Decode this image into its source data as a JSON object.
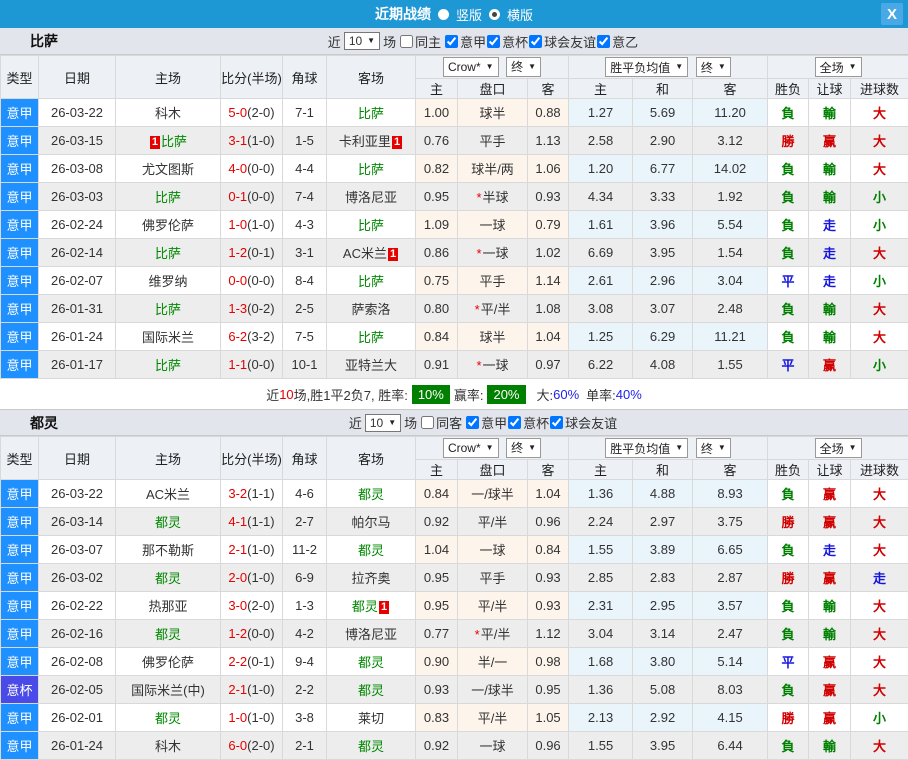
{
  "colors": {
    "titlebar": "#1E97D5",
    "close_btn": "#48A9E6",
    "band_bg": "#E2E5EC",
    "header_bg": "#EDF0F5",
    "serie_a": "#1E90FF",
    "coppa": "#4A4AE8",
    "focus_team": "#008800",
    "win_red": "#D10000",
    "lose_green": "#008000",
    "draw_blue": "#1515E0",
    "score_red": "#E60000",
    "tint_crow": "#FDF5EC",
    "tint_avg": "#EAF4FB",
    "badge_green": "#008000",
    "pct_blue": "#2222EE",
    "row_alt": "#EDEDED"
  },
  "titlebar": {
    "title": "近期战绩",
    "layout_vertical": "竖版",
    "layout_horizontal": "横版",
    "close": "X"
  },
  "columns": {
    "type": "类型",
    "date": "日期",
    "home": "主场",
    "score": "比分(半场)",
    "corner": "角球",
    "away": "客场",
    "h": "主",
    "handicap": "盘口",
    "a": "客",
    "eh": "主",
    "draw": "和",
    "ea": "客",
    "result": "胜负",
    "let": "让球",
    "goals": "进球数"
  },
  "selects": {
    "bookmaker": "Crow*",
    "final": "终",
    "wdl": "胜平负均值",
    "final2": "终",
    "scope": "全场"
  },
  "sections": [
    {
      "team": "比萨",
      "filter": {
        "near": "近",
        "count": "10",
        "games": "场",
        "same": {
          "label": "同主",
          "checked": false
        },
        "leagues": [
          {
            "label": "意甲",
            "checked": true
          },
          {
            "label": "意杯",
            "checked": true
          },
          {
            "label": "球会友谊",
            "checked": true
          },
          {
            "label": "意乙",
            "checked": true
          }
        ]
      },
      "rows": [
        {
          "lg": "意甲",
          "lgc": "jia",
          "date": "26-03-22",
          "home": "科木",
          "hf": 0,
          "hcard": 0,
          "ft": "5-0",
          "ht": "(2-0)",
          "cn": "7-1",
          "away": "比萨",
          "af": 1,
          "acard": 0,
          "o1": "1.00",
          "star": 0,
          "hc": "球半",
          "o2": "0.88",
          "e1": "1.27",
          "e2": "5.69",
          "e3": "11.20",
          "r": "負",
          "rc": "g",
          "h": "輸",
          "hcl": "g",
          "g": "大",
          "gc": "r"
        },
        {
          "lg": "意甲",
          "lgc": "jia",
          "date": "26-03-15",
          "home": "比萨",
          "hf": 1,
          "hcard": 1,
          "ft": "3-1",
          "ht": "(1-0)",
          "cn": "1-5",
          "away": "卡利亚里",
          "af": 0,
          "acard": 1,
          "o1": "0.76",
          "star": 0,
          "hc": "平手",
          "o2": "1.13",
          "e1": "2.58",
          "e2": "2.90",
          "e3": "3.12",
          "r": "勝",
          "rc": "r",
          "h": "赢",
          "hcl": "r",
          "g": "大",
          "gc": "r"
        },
        {
          "lg": "意甲",
          "lgc": "jia",
          "date": "26-03-08",
          "home": "尤文图斯",
          "hf": 0,
          "hcard": 0,
          "ft": "4-0",
          "ht": "(0-0)",
          "cn": "4-4",
          "away": "比萨",
          "af": 1,
          "acard": 0,
          "o1": "0.82",
          "star": 0,
          "hc": "球半/两",
          "o2": "1.06",
          "e1": "1.20",
          "e2": "6.77",
          "e3": "14.02",
          "r": "負",
          "rc": "g",
          "h": "輸",
          "hcl": "g",
          "g": "大",
          "gc": "r"
        },
        {
          "lg": "意甲",
          "lgc": "jia",
          "date": "26-03-03",
          "home": "比萨",
          "hf": 1,
          "hcard": 0,
          "ft": "0-1",
          "ht": "(0-0)",
          "cn": "7-4",
          "away": "博洛尼亚",
          "af": 0,
          "acard": 0,
          "o1": "0.95",
          "star": 1,
          "hc": "半球",
          "o2": "0.93",
          "e1": "4.34",
          "e2": "3.33",
          "e3": "1.92",
          "r": "負",
          "rc": "g",
          "h": "輸",
          "hcl": "g",
          "g": "小",
          "gc": "g"
        },
        {
          "lg": "意甲",
          "lgc": "jia",
          "date": "26-02-24",
          "home": "佛罗伦萨",
          "hf": 0,
          "hcard": 0,
          "ft": "1-0",
          "ht": "(1-0)",
          "cn": "4-3",
          "away": "比萨",
          "af": 1,
          "acard": 0,
          "o1": "1.09",
          "star": 0,
          "hc": "一球",
          "o2": "0.79",
          "e1": "1.61",
          "e2": "3.96",
          "e3": "5.54",
          "r": "負",
          "rc": "g",
          "h": "走",
          "hcl": "b",
          "g": "小",
          "gc": "g"
        },
        {
          "lg": "意甲",
          "lgc": "jia",
          "date": "26-02-14",
          "home": "比萨",
          "hf": 1,
          "hcard": 0,
          "ft": "1-2",
          "ht": "(0-1)",
          "cn": "3-1",
          "away": "AC米兰",
          "af": 0,
          "acard": 1,
          "o1": "0.86",
          "star": 1,
          "hc": "一球",
          "o2": "1.02",
          "e1": "6.69",
          "e2": "3.95",
          "e3": "1.54",
          "r": "負",
          "rc": "g",
          "h": "走",
          "hcl": "b",
          "g": "大",
          "gc": "r"
        },
        {
          "lg": "意甲",
          "lgc": "jia",
          "date": "26-02-07",
          "home": "维罗纳",
          "hf": 0,
          "hcard": 0,
          "ft": "0-0",
          "ht": "(0-0)",
          "cn": "8-4",
          "away": "比萨",
          "af": 1,
          "acard": 0,
          "o1": "0.75",
          "star": 0,
          "hc": "平手",
          "o2": "1.14",
          "e1": "2.61",
          "e2": "2.96",
          "e3": "3.04",
          "r": "平",
          "rc": "b",
          "h": "走",
          "hcl": "b",
          "g": "小",
          "gc": "g"
        },
        {
          "lg": "意甲",
          "lgc": "jia",
          "date": "26-01-31",
          "home": "比萨",
          "hf": 1,
          "hcard": 0,
          "ft": "1-3",
          "ht": "(0-2)",
          "cn": "2-5",
          "away": "萨索洛",
          "af": 0,
          "acard": 0,
          "o1": "0.80",
          "star": 1,
          "hc": "平/半",
          "o2": "1.08",
          "e1": "3.08",
          "e2": "3.07",
          "e3": "2.48",
          "r": "負",
          "rc": "g",
          "h": "輸",
          "hcl": "g",
          "g": "大",
          "gc": "r"
        },
        {
          "lg": "意甲",
          "lgc": "jia",
          "date": "26-01-24",
          "home": "国际米兰",
          "hf": 0,
          "hcard": 0,
          "ft": "6-2",
          "ht": "(3-2)",
          "cn": "7-5",
          "away": "比萨",
          "af": 1,
          "acard": 0,
          "o1": "0.84",
          "star": 0,
          "hc": "球半",
          "o2": "1.04",
          "e1": "1.25",
          "e2": "6.29",
          "e3": "11.21",
          "r": "負",
          "rc": "g",
          "h": "輸",
          "hcl": "g",
          "g": "大",
          "gc": "r"
        },
        {
          "lg": "意甲",
          "lgc": "jia",
          "date": "26-01-17",
          "home": "比萨",
          "hf": 1,
          "hcard": 0,
          "ft": "1-1",
          "ht": "(0-0)",
          "cn": "10-1",
          "away": "亚特兰大",
          "af": 0,
          "acard": 0,
          "o1": "0.91",
          "star": 1,
          "hc": "一球",
          "o2": "0.97",
          "e1": "6.22",
          "e2": "4.08",
          "e3": "1.55",
          "r": "平",
          "rc": "b",
          "h": "赢",
          "hcl": "r",
          "g": "小",
          "gc": "g"
        }
      ],
      "summary": {
        "pre": "近",
        "count": "10",
        "mid": "场,胜1平2负7, 胜率:",
        "win_pct": "10%",
        "mid2": "赢率:",
        "wl_pct": "20%",
        "big_label": "大:",
        "big_pct": "60%",
        "single_label": "单率:",
        "single_pct": "40%"
      }
    },
    {
      "team": "都灵",
      "filter": {
        "near": "近",
        "count": "10",
        "games": "场",
        "same": {
          "label": "同客",
          "checked": false
        },
        "leagues": [
          {
            "label": "意甲",
            "checked": true
          },
          {
            "label": "意杯",
            "checked": true
          },
          {
            "label": "球会友谊",
            "checked": true
          }
        ]
      },
      "rows": [
        {
          "lg": "意甲",
          "lgc": "jia",
          "date": "26-03-22",
          "home": "AC米兰",
          "hf": 0,
          "hcard": 0,
          "ft": "3-2",
          "ht": "(1-1)",
          "cn": "4-6",
          "away": "都灵",
          "af": 1,
          "acard": 0,
          "o1": "0.84",
          "star": 0,
          "hc": "一/球半",
          "o2": "1.04",
          "e1": "1.36",
          "e2": "4.88",
          "e3": "8.93",
          "r": "負",
          "rc": "g",
          "h": "赢",
          "hcl": "r",
          "g": "大",
          "gc": "r"
        },
        {
          "lg": "意甲",
          "lgc": "jia",
          "date": "26-03-14",
          "home": "都灵",
          "hf": 1,
          "hcard": 0,
          "ft": "4-1",
          "ht": "(1-1)",
          "cn": "2-7",
          "away": "帕尔马",
          "af": 0,
          "acard": 0,
          "o1": "0.92",
          "star": 0,
          "hc": "平/半",
          "o2": "0.96",
          "e1": "2.24",
          "e2": "2.97",
          "e3": "3.75",
          "r": "勝",
          "rc": "r",
          "h": "赢",
          "hcl": "r",
          "g": "大",
          "gc": "r"
        },
        {
          "lg": "意甲",
          "lgc": "jia",
          "date": "26-03-07",
          "home": "那不勒斯",
          "hf": 0,
          "hcard": 0,
          "ft": "2-1",
          "ht": "(1-0)",
          "cn": "11-2",
          "away": "都灵",
          "af": 1,
          "acard": 0,
          "o1": "1.04",
          "star": 0,
          "hc": "一球",
          "o2": "0.84",
          "e1": "1.55",
          "e2": "3.89",
          "e3": "6.65",
          "r": "負",
          "rc": "g",
          "h": "走",
          "hcl": "b",
          "g": "大",
          "gc": "r"
        },
        {
          "lg": "意甲",
          "lgc": "jia",
          "date": "26-03-02",
          "home": "都灵",
          "hf": 1,
          "hcard": 0,
          "ft": "2-0",
          "ht": "(1-0)",
          "cn": "6-9",
          "away": "拉齐奥",
          "af": 0,
          "acard": 0,
          "o1": "0.95",
          "star": 0,
          "hc": "平手",
          "o2": "0.93",
          "e1": "2.85",
          "e2": "2.83",
          "e3": "2.87",
          "r": "勝",
          "rc": "r",
          "h": "赢",
          "hcl": "r",
          "g": "走",
          "gc": "b"
        },
        {
          "lg": "意甲",
          "lgc": "jia",
          "date": "26-02-22",
          "home": "热那亚",
          "hf": 0,
          "hcard": 0,
          "ft": "3-0",
          "ht": "(2-0)",
          "cn": "1-3",
          "away": "都灵",
          "af": 1,
          "acard": 1,
          "o1": "0.95",
          "star": 0,
          "hc": "平/半",
          "o2": "0.93",
          "e1": "2.31",
          "e2": "2.95",
          "e3": "3.57",
          "r": "負",
          "rc": "g",
          "h": "輸",
          "hcl": "g",
          "g": "大",
          "gc": "r"
        },
        {
          "lg": "意甲",
          "lgc": "jia",
          "date": "26-02-16",
          "home": "都灵",
          "hf": 1,
          "hcard": 0,
          "ft": "1-2",
          "ht": "(0-0)",
          "cn": "4-2",
          "away": "博洛尼亚",
          "af": 0,
          "acard": 0,
          "o1": "0.77",
          "star": 1,
          "hc": "平/半",
          "o2": "1.12",
          "e1": "3.04",
          "e2": "3.14",
          "e3": "2.47",
          "r": "負",
          "rc": "g",
          "h": "輸",
          "hcl": "g",
          "g": "大",
          "gc": "r"
        },
        {
          "lg": "意甲",
          "lgc": "jia",
          "date": "26-02-08",
          "home": "佛罗伦萨",
          "hf": 0,
          "hcard": 0,
          "ft": "2-2",
          "ht": "(0-1)",
          "cn": "9-4",
          "away": "都灵",
          "af": 1,
          "acard": 0,
          "o1": "0.90",
          "star": 0,
          "hc": "半/一",
          "o2": "0.98",
          "e1": "1.68",
          "e2": "3.80",
          "e3": "5.14",
          "r": "平",
          "rc": "b",
          "h": "赢",
          "hcl": "r",
          "g": "大",
          "gc": "r"
        },
        {
          "lg": "意杯",
          "lgc": "bei",
          "date": "26-02-05",
          "home": "国际米兰(中)",
          "hf": 0,
          "hcard": 0,
          "ft": "2-1",
          "ht": "(1-0)",
          "cn": "2-2",
          "away": "都灵",
          "af": 1,
          "acard": 0,
          "o1": "0.93",
          "star": 0,
          "hc": "一/球半",
          "o2": "0.95",
          "e1": "1.36",
          "e2": "5.08",
          "e3": "8.03",
          "r": "負",
          "rc": "g",
          "h": "赢",
          "hcl": "r",
          "g": "大",
          "gc": "r"
        },
        {
          "lg": "意甲",
          "lgc": "jia",
          "date": "26-02-01",
          "home": "都灵",
          "hf": 1,
          "hcard": 0,
          "ft": "1-0",
          "ht": "(1-0)",
          "cn": "3-8",
          "away": "莱切",
          "af": 0,
          "acard": 0,
          "o1": "0.83",
          "star": 0,
          "hc": "平/半",
          "o2": "1.05",
          "e1": "2.13",
          "e2": "2.92",
          "e3": "4.15",
          "r": "勝",
          "rc": "r",
          "h": "赢",
          "hcl": "r",
          "g": "小",
          "gc": "g"
        },
        {
          "lg": "意甲",
          "lgc": "jia",
          "date": "26-01-24",
          "home": "科木",
          "hf": 0,
          "hcard": 0,
          "ft": "6-0",
          "ht": "(2-0)",
          "cn": "2-1",
          "away": "都灵",
          "af": 1,
          "acard": 0,
          "o1": "0.92",
          "star": 0,
          "hc": "一球",
          "o2": "0.96",
          "e1": "1.55",
          "e2": "3.95",
          "e3": "6.44",
          "r": "負",
          "rc": "g",
          "h": "輸",
          "hcl": "g",
          "g": "大",
          "gc": "r"
        }
      ]
    }
  ]
}
